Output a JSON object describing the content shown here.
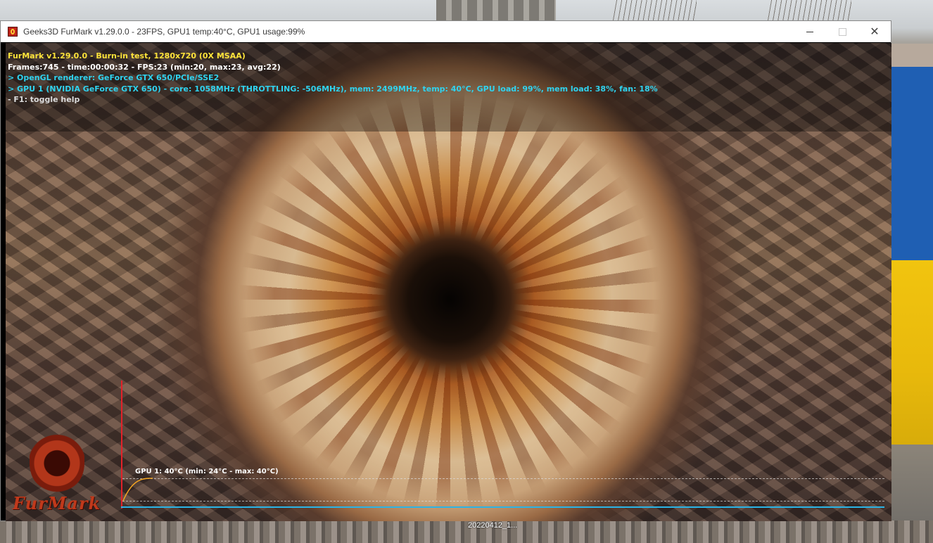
{
  "window": {
    "title": "Geeks3D FurMark v1.29.0.0 - 23FPS, GPU1 temp:40°C, GPU1 usage:99%",
    "controls": {
      "minimize": "—",
      "maximize": "☐",
      "close": "✕"
    }
  },
  "hud": {
    "line1": "FurMark v1.29.0.0 - Burn-in test, 1280x720 (0X MSAA)",
    "line2": "Frames:745 - time:00:00:32 - FPS:23 (min:20, max:23, avg:22)",
    "line3": "> OpenGL renderer: GeForce GTX 650/PCIe/SSE2",
    "line4": "> GPU 1 (NVIDIA GeForce GTX 650) - core: 1058MHz (THROTTLING: -506MHz), mem: 2499MHz, temp: 40°C, GPU load: 99%, mem load: 38%, fan: 18%",
    "line5": "- F1: toggle help"
  },
  "logo": {
    "text": "FurMark"
  },
  "temp_graph": {
    "label": "GPU 1: 40°C (min: 24°C - max: 40°C)",
    "min": 24,
    "max": 40,
    "current": 40,
    "line_color": "#f5a623",
    "axis_y_color": "#e2222a",
    "axis_x_color": "#2bb4e6"
  },
  "desktop": {
    "file_label": "20220412_1..."
  },
  "colors": {
    "hud_title": "#ffe43a",
    "hud_info": "#2fd3f0"
  }
}
